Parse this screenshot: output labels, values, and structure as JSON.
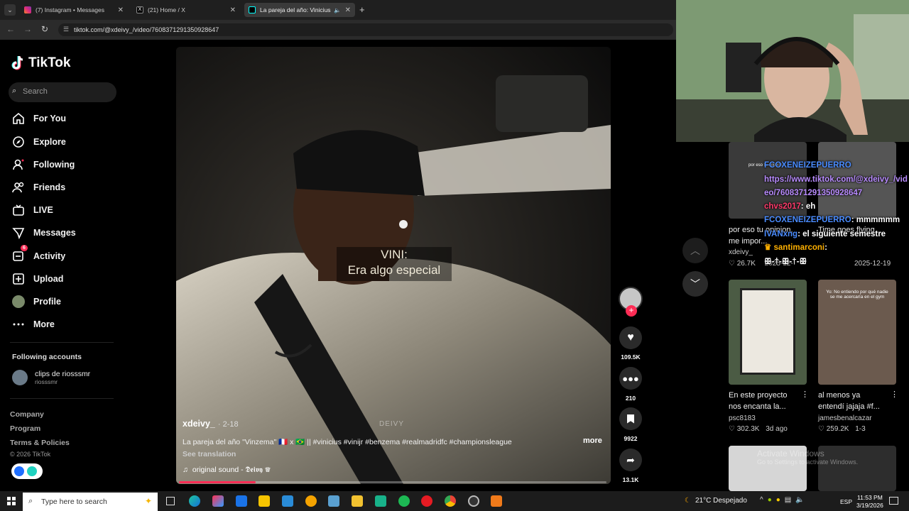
{
  "browser": {
    "tabs": [
      {
        "label": "(7) Instagram • Messages",
        "active": false
      },
      {
        "label": "(21) Home / X",
        "active": false
      },
      {
        "label": "La pareja del año: Vinicius",
        "active": true
      }
    ],
    "url": "tiktok.com/@xdeivy_/video/7608371291350928647"
  },
  "sidebar": {
    "logo": "TikTok",
    "search_placeholder": "Search",
    "nav": [
      {
        "label": "For You",
        "icon": "home-icon"
      },
      {
        "label": "Explore",
        "icon": "compass-icon"
      },
      {
        "label": "Following",
        "icon": "following-icon"
      },
      {
        "label": "Friends",
        "icon": "friends-icon"
      },
      {
        "label": "LIVE",
        "icon": "live-icon"
      },
      {
        "label": "Messages",
        "icon": "messages-icon"
      },
      {
        "label": "Activity",
        "icon": "activity-icon",
        "badge": "6"
      },
      {
        "label": "Upload",
        "icon": "upload-icon"
      },
      {
        "label": "Profile",
        "icon": "avatar-icon"
      },
      {
        "label": "More",
        "icon": "more-icon"
      }
    ],
    "following_header": "Following accounts",
    "following": [
      {
        "name": "clips de riosssmr",
        "handle": "riosssmr"
      }
    ],
    "footer": [
      "Company",
      "Program",
      "Terms & Policies"
    ],
    "copyright": "© 2026 TikTok"
  },
  "video": {
    "subtitle_speaker": "VINI:",
    "subtitle_text": "Era algo especial",
    "watermark": "DEIVY",
    "author": "xdeivy_",
    "date": "· 2-18",
    "caption": "La pareja del año \"Vinzema\" 🇫🇷 x 🇧🇷 || #vinicius #vinijr #benzema #realmadridfc #championsleague",
    "more": "more",
    "see_translation": "See translation",
    "sound": "original sound - 𝕯𝖊𝖎𝖛𝖞 ♕",
    "progress": 0.18
  },
  "actions": {
    "likes": "109.5K",
    "comments": "210",
    "saves": "9922",
    "shares": "13.1K"
  },
  "recommendations": [
    {
      "title1": "por eso tu opinion,",
      "title2": "me impor...",
      "author": "xdeivy_",
      "stats": "26.7K",
      "date": "2025-12-"
    },
    {
      "title1": "Time goes flying,",
      "title2": "",
      "author": "",
      "stats": "",
      "date": "2025-12-19"
    },
    {
      "title1": "En este proyecto",
      "title2": "nos encanta la...",
      "author": "psc8183",
      "stats": "302.3K",
      "date": "3d ago"
    },
    {
      "title1": "al menos ya",
      "title2": "entendí jajaja #f...",
      "author": "jamesbenalcazar",
      "stats": "259.2K",
      "date": "1-3"
    }
  ],
  "thumb_text": {
    "t1": "por eso tu opinion",
    "t4": "Yo: No entiendo por qué nadie se me acercaría en el gym"
  },
  "chat": [
    {
      "user": "FCOXENEIZEPUERRO",
      "msg": "",
      "color": "#4a8cff"
    },
    {
      "user": "",
      "msg": "https://www.tiktok.com/@xdeivy_/video/7608371291350928647",
      "color": "#b98cff"
    },
    {
      "user": "chvs2017",
      "msg": ": eh",
      "color": "#ff3b6b"
    },
    {
      "user": "FCOXENEIZEPUERRO",
      "msg": ": mmmmmm",
      "color": "#4a8cff"
    },
    {
      "user": "IVANxng",
      "msg": ": el siguiente semestre",
      "color": "#4a8cff"
    },
    {
      "user": "santimarconi",
      "msg": ":",
      "color": "#ffb000"
    },
    {
      "user": "",
      "msg": "ꕥ-†-ꕥ-†-ꕥ",
      "color": "#ffffff"
    }
  ],
  "activate": {
    "title": "Activate Windows",
    "sub": "Go to Settings to activate Windows."
  },
  "taskbar": {
    "search": "Type here to search",
    "weather": "21°C  Despejado",
    "lang": "ESP",
    "time": "11:53 PM",
    "date": "3/19/2026"
  }
}
